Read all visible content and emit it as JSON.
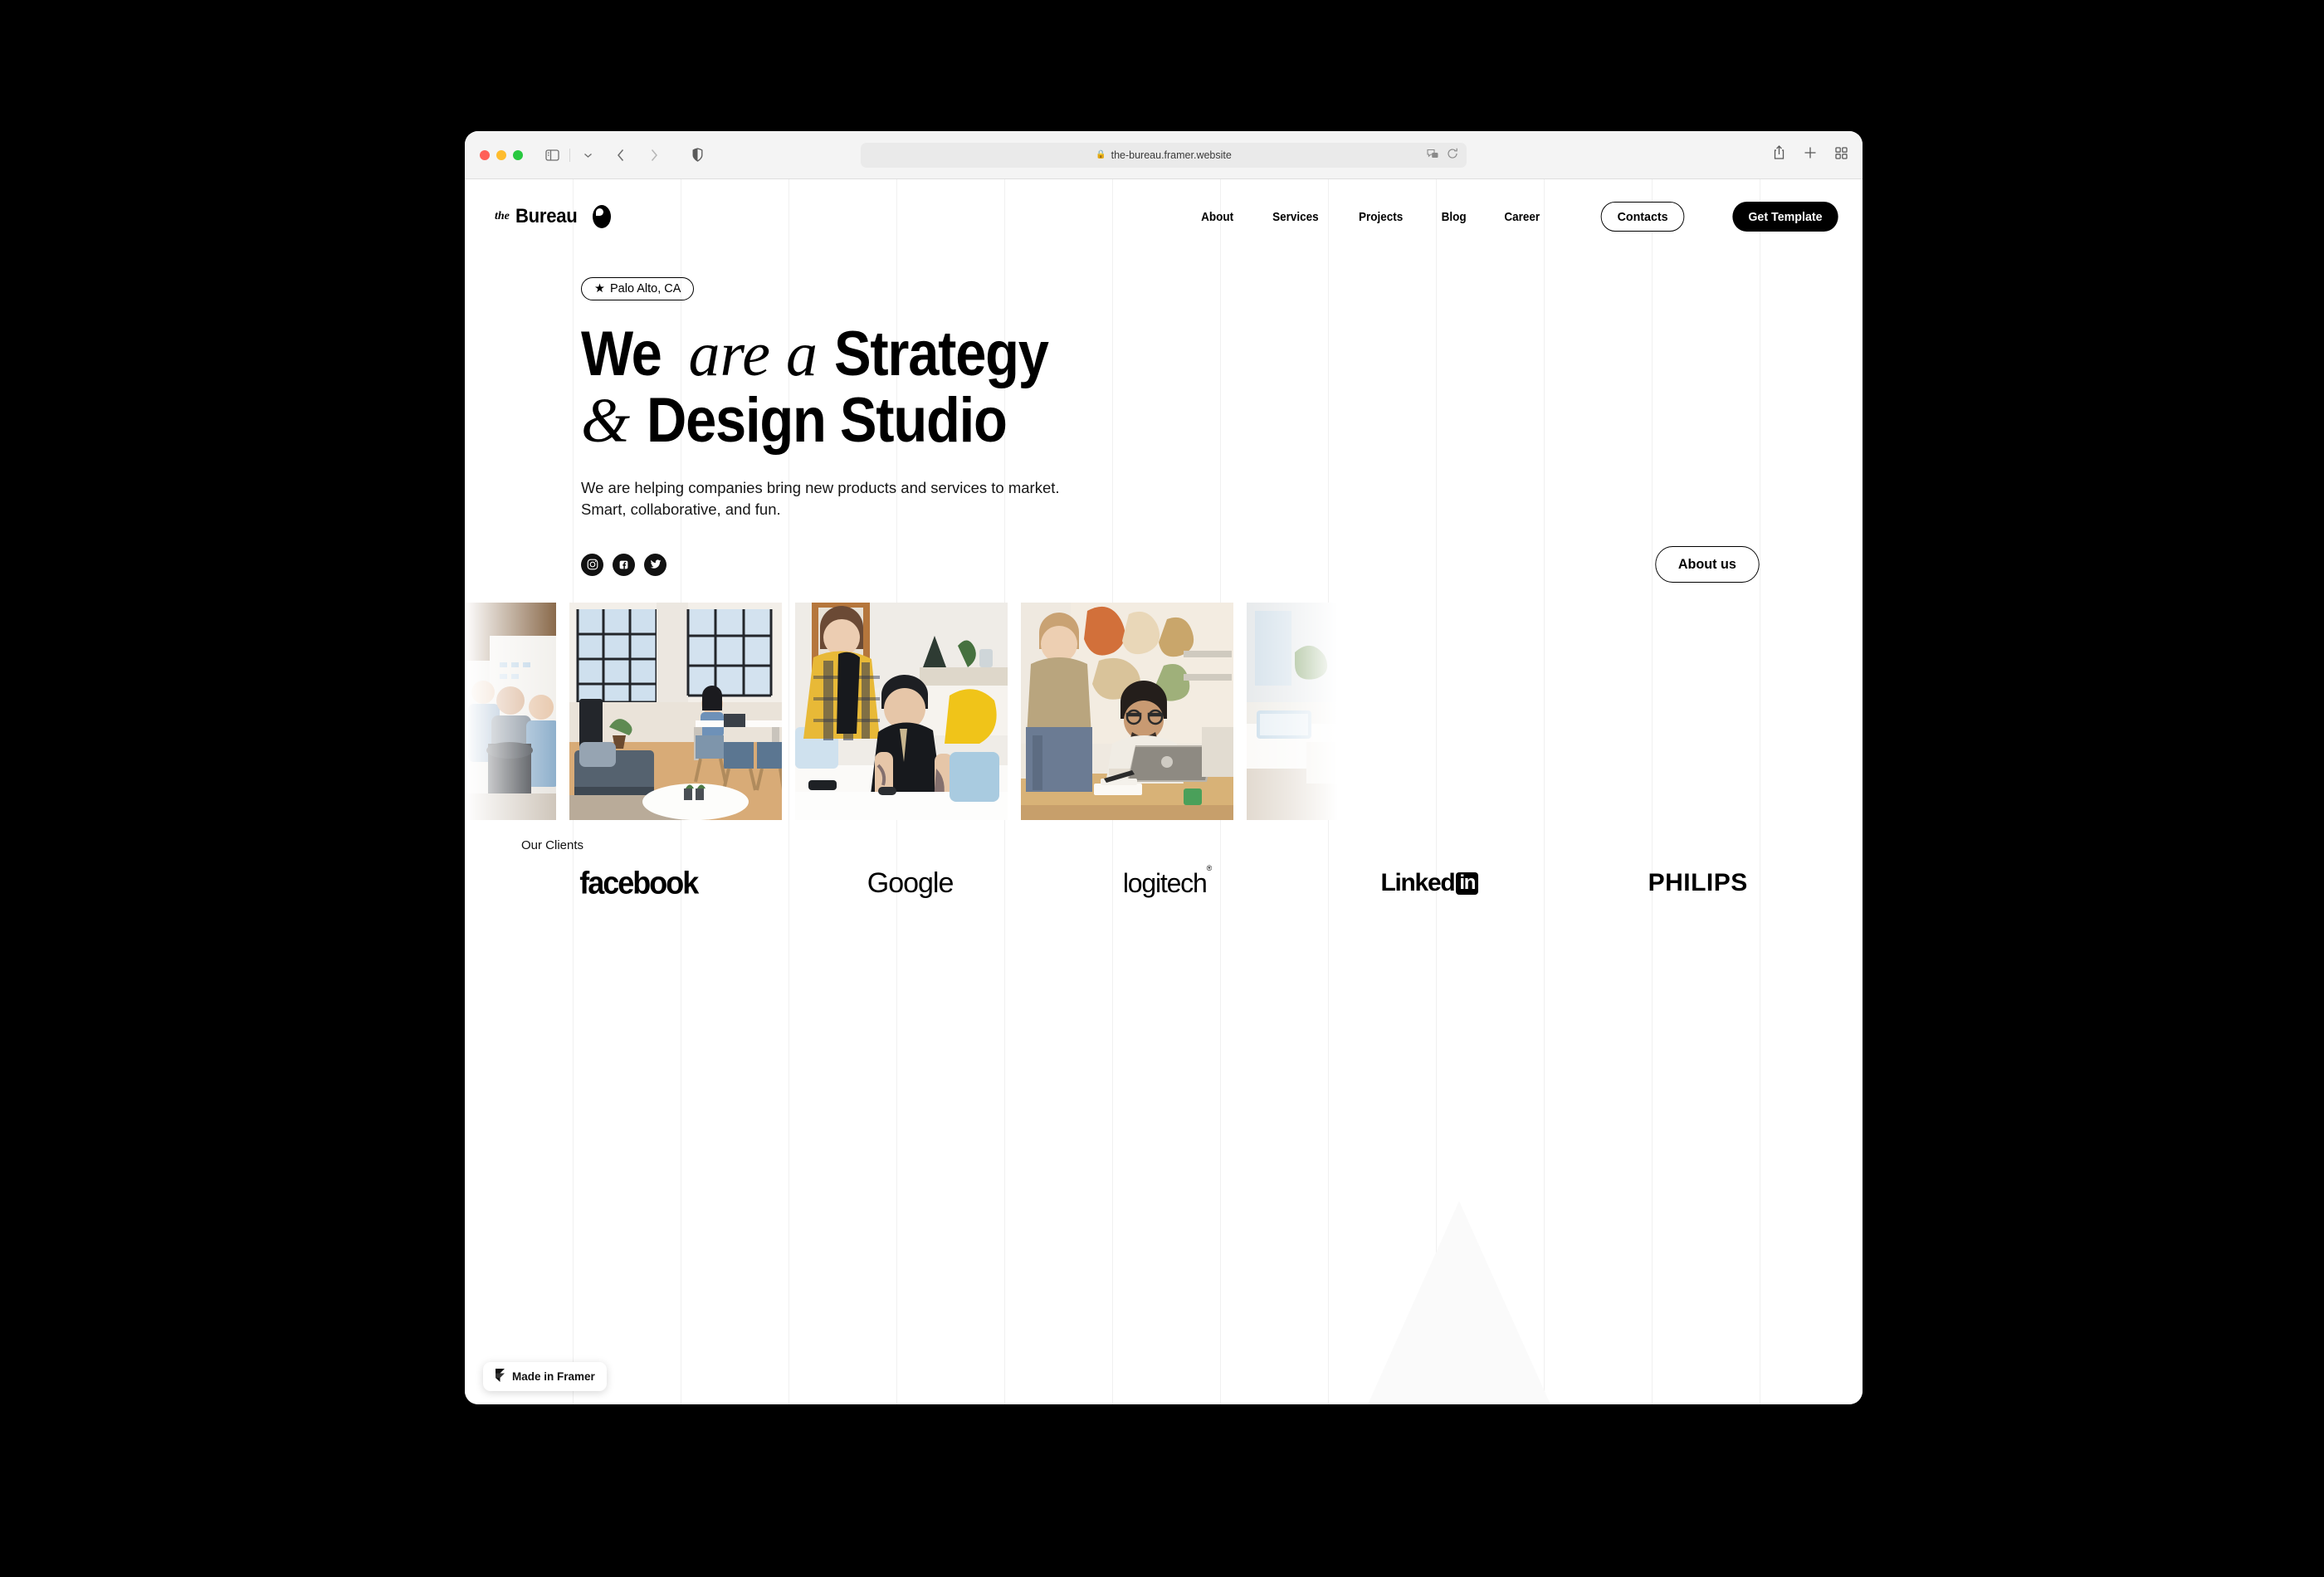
{
  "browser": {
    "url": "the-bureau.framer.website",
    "lock_icon": "lock-icon",
    "traffic_lights": [
      "close-red",
      "minimize-yellow",
      "maximize-green"
    ],
    "toolbar_icons": [
      "sidebar-icon",
      "chevron-down-icon",
      "back-icon",
      "forward-icon",
      "shield-icon",
      "translate-icon",
      "reload-icon",
      "share-icon",
      "new-tab-icon",
      "tab-overview-icon"
    ]
  },
  "site": {
    "logo": {
      "prefix": "the",
      "name": "Bureau"
    },
    "nav": [
      {
        "label": "About"
      },
      {
        "label": "Services"
      },
      {
        "label": "Projects"
      },
      {
        "label": "Blog"
      },
      {
        "label": "Career"
      }
    ],
    "buttons": {
      "contacts": "Contacts",
      "get_template": "Get Template",
      "about_us": "About us"
    }
  },
  "hero": {
    "badge": {
      "star": "★",
      "text": "Palo Alto, CA"
    },
    "headline": {
      "line1_a": "We",
      "line1_italic": "are a",
      "line1_b": "Strategy",
      "line2_italic": "&",
      "line2_b": "Design Studio"
    },
    "subtitle_line1": "We are helping companies bring new products and services to market.",
    "subtitle_line2": "Smart, collaborative, and fun.",
    "socials": [
      {
        "name": "instagram-icon"
      },
      {
        "name": "facebook-icon"
      },
      {
        "name": "twitter-icon"
      }
    ]
  },
  "gallery": {
    "items": [
      {
        "alt": "office-meeting-team"
      },
      {
        "alt": "loft-office-interior"
      },
      {
        "alt": "coworkers-at-desk"
      },
      {
        "alt": "team-around-laptop"
      },
      {
        "alt": "bright-workspace"
      }
    ]
  },
  "clients": {
    "label": "Our Clients",
    "logos": [
      {
        "name": "facebook",
        "text": "facebook"
      },
      {
        "name": "google",
        "text": "Google"
      },
      {
        "name": "logitech",
        "text": "logitech",
        "mark": "®"
      },
      {
        "name": "linkedin",
        "text": "Linked",
        "box": "in"
      },
      {
        "name": "philips",
        "text": "PHILIPS"
      }
    ]
  },
  "footer_badge": {
    "text": "Made in Framer",
    "icon": "framer-logo-icon"
  },
  "colors": {
    "accent": "#000000",
    "page_bg": "#ffffff",
    "toolbar_bg": "#f4f4f4",
    "grid_line": "#f0f0f0"
  }
}
